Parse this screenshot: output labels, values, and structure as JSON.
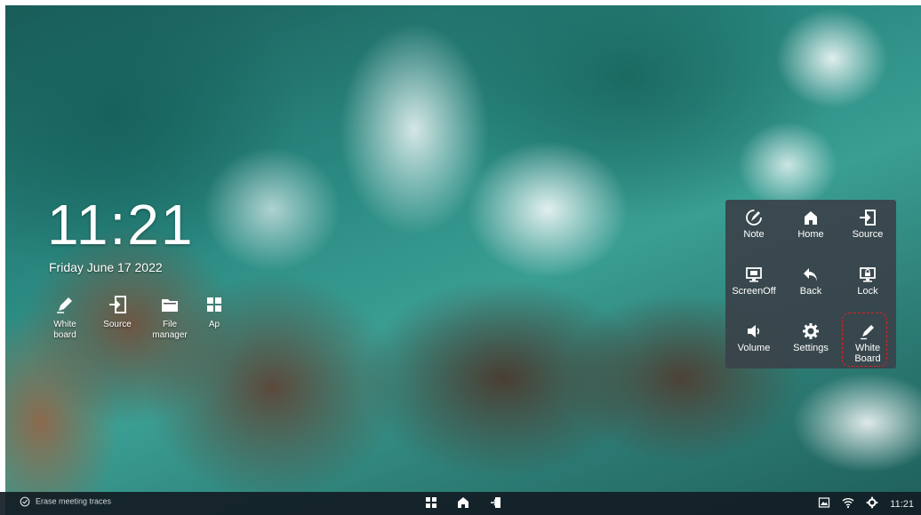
{
  "home": {
    "time": "11:21",
    "date": "Friday June 17 2022",
    "apps": [
      {
        "label": "White\nboard",
        "icon": "pen-icon"
      },
      {
        "label": "Source",
        "icon": "source-icon"
      },
      {
        "label": "File\nmanager",
        "icon": "folder-icon"
      },
      {
        "label": "Ap",
        "icon": "apps-grid-icon"
      }
    ]
  },
  "panel": {
    "items": [
      {
        "label": "Note",
        "icon": "note-icon"
      },
      {
        "label": "Home",
        "icon": "home-icon"
      },
      {
        "label": "Source",
        "icon": "source-icon"
      },
      {
        "label": "ScreenOff",
        "icon": "screen-off-icon"
      },
      {
        "label": "Back",
        "icon": "back-icon"
      },
      {
        "label": "Lock",
        "icon": "lock-screen-icon"
      },
      {
        "label": "Volume",
        "icon": "volume-icon"
      },
      {
        "label": "Settings",
        "icon": "gear-icon"
      },
      {
        "label": "White\nBoard",
        "icon": "pen-icon"
      }
    ],
    "highlight_color": "#e02020"
  },
  "taskbar": {
    "left_text": "Erase meeting traces",
    "left_icon": "erase-check-icon",
    "center_icons": [
      "apps-grid-icon",
      "home-icon",
      "source-icon"
    ],
    "right_icons": [
      "screenshot-icon",
      "wifi-icon",
      "gear-icon"
    ],
    "time": "11:21"
  },
  "colors": {
    "panel_bg": "#3a424a",
    "taskbar_bg": "#121c24",
    "text": "#ffffff"
  }
}
